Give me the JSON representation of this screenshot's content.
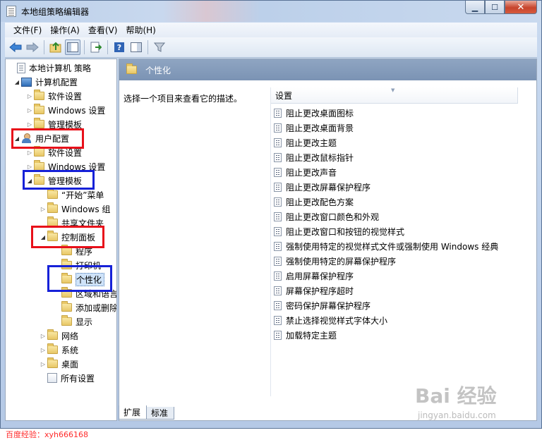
{
  "window": {
    "title": "本地组策略编辑器"
  },
  "menu": [
    "文件(F)",
    "操作(A)",
    "查看(V)",
    "帮助(H)"
  ],
  "toolbar": {
    "buttons": [
      "back-arrow-icon",
      "forward-arrow-icon",
      "up-folder-icon",
      "show-hide-tree-icon",
      "export-list-icon",
      "help-icon",
      "properties-pane-icon",
      "filter-icon"
    ]
  },
  "tree": {
    "root": "本地计算机 策略",
    "computer_config": "计算机配置",
    "cc_software": "软件设置",
    "cc_windows": "Windows 设置",
    "cc_admin": "管理模板",
    "user_config": "用户配置",
    "uc_software": "软件设置",
    "uc_windows": "Windows 设置",
    "uc_admin": "管理模板",
    "start_menu": "“开始”菜单",
    "windows_components": "Windows 组",
    "shared_folders": "共享文件夹",
    "control_panel": "控制面板",
    "programs": "程序",
    "printers": "打印机",
    "personalization": "个性化",
    "regional": "区域和语言",
    "add_remove": "添加或删除",
    "display": "显示",
    "network": "网络",
    "system": "系统",
    "desktop": "桌面",
    "all_settings": "所有设置"
  },
  "right": {
    "header": "个性化",
    "description": "选择一个项目来查看它的描述。",
    "column_setting": "设置",
    "policies": [
      "阻止更改桌面图标",
      "阻止更改桌面背景",
      "阻止更改主题",
      "阻止更改鼠标指针",
      "阻止更改声音",
      "阻止更改屏幕保护程序",
      "阻止更改配色方案",
      "阻止更改窗口颜色和外观",
      "阻止更改窗口和按钮的视觉样式",
      "强制使用特定的视觉样式文件或强制使用 Windows 经典",
      "强制使用特定的屏幕保护程序",
      "启用屏幕保护程序",
      "屏幕保护程序超时",
      "密码保护屏幕保护程序",
      "禁止选择视觉样式字体大小",
      "加载特定主题"
    ]
  },
  "tabs": {
    "extended": "扩展",
    "standard": "标准"
  },
  "footer": {
    "watermark": "百度经验：xyh666168"
  },
  "brand": {
    "baidu": "Bai 经验",
    "baidu_url": "jingyan.baidu.com"
  },
  "colors": {
    "highlight_red": "#e8101a",
    "highlight_blue": "#1621d8",
    "header_blue": "#7b93b4"
  }
}
